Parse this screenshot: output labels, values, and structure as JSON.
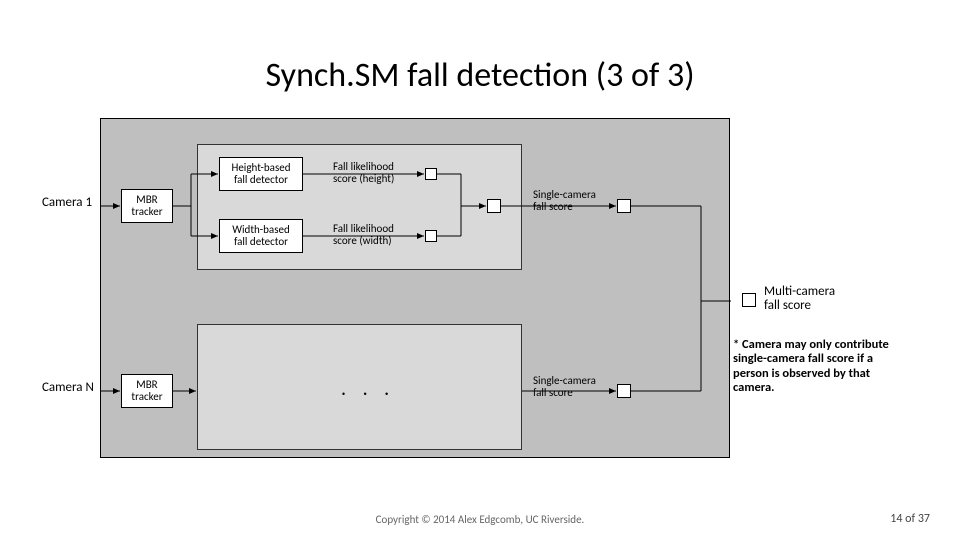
{
  "title": "Synch.SM fall detection (3 of 3)",
  "labels": {
    "camera1": "Camera 1",
    "cameraN": "Camera N",
    "mbr": "MBR\ntracker",
    "height_detector": "Height-based\nfall detector",
    "width_detector": "Width-based\nfall detector",
    "height_score": "Fall likelihood\nscore (height)",
    "width_score": "Fall likelihood\nscore (width)",
    "single_cam": "Single-camera\nfall score",
    "multi_cam": "Multi-camera\nfall score",
    "dots": ". . ."
  },
  "note": "* Camera may only contribute single-camera fall score if a person is observed by that camera.",
  "footer": {
    "copyright": "Copyright © 2014 Alex Edgcomb, UC Riverside.",
    "page": "14 of 37"
  }
}
